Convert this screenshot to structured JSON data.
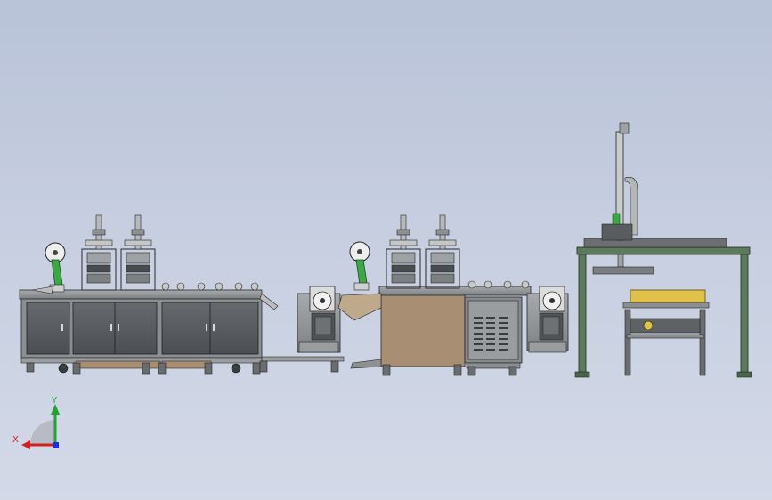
{
  "scene": {
    "view": "front",
    "modules": [
      "left-press-station-with-cabinets",
      "left-winder-unit",
      "center-press-station",
      "electrical-cabinet",
      "right-winder-unit",
      "gantry-with-vertical-cylinder",
      "gantry-roller-frame"
    ]
  },
  "triad": {
    "x_label": "X",
    "y_label": "Y",
    "colors": {
      "x": "#d21f1f",
      "y": "#1fa431",
      "z": "#1e2fd0"
    }
  },
  "colors": {
    "background_top": "#b9c3d8",
    "background_bottom": "#d3d9e7",
    "cabinet": "#55595d",
    "frame": "#8c8f92",
    "wood_panel": "#a88f74",
    "gantry": "#5d7a5d",
    "accent_green": "#3ca844",
    "roller_yellow": "#e0c24a"
  }
}
